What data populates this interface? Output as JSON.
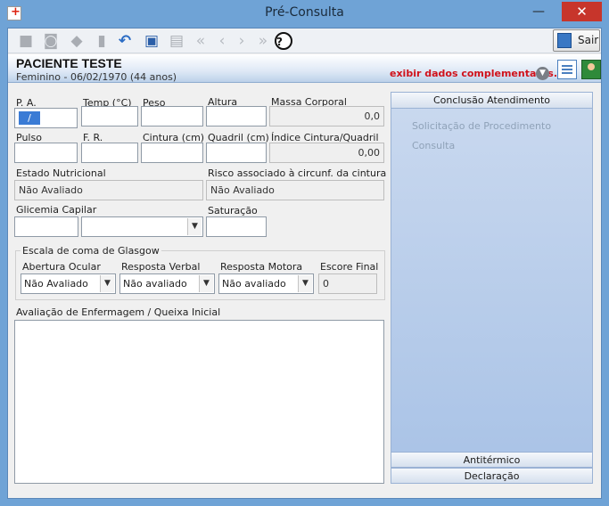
{
  "window": {
    "title": "Pré-Consulta",
    "min": "—",
    "max": "□",
    "close": "✕"
  },
  "toolbar": {
    "exit_label": "Sair",
    "help": "?"
  },
  "patient": {
    "name": "PACIENTE TESTE",
    "info": "Feminino - 06/02/1970 (44 anos)",
    "extra_link": "exibir dados complementares..."
  },
  "form": {
    "pa": {
      "label": "P. A.",
      "value": "/"
    },
    "temp": {
      "label": "Temp (°C)",
      "value": ""
    },
    "peso": {
      "label": "Peso",
      "value": ""
    },
    "altura": {
      "label": "Altura",
      "value": ""
    },
    "massa": {
      "label": "Massa Corporal",
      "value": "0,0"
    },
    "pulso": {
      "label": "Pulso",
      "value": ""
    },
    "fr": {
      "label": "F. R.",
      "value": ""
    },
    "cintura": {
      "label": "Cintura (cm)",
      "value": ""
    },
    "quadril": {
      "label": "Quadril (cm)",
      "value": ""
    },
    "indice": {
      "label": "Índice Cintura/Quadril",
      "value": "0,00"
    },
    "estado": {
      "label": "Estado Nutricional",
      "value": "Não Avaliado"
    },
    "risco": {
      "label": "Risco associado à circunf. da cintura",
      "value": "Não Avaliado"
    },
    "glicemia": {
      "label": "Glicemia Capilar",
      "value": "",
      "select": ""
    },
    "saturacao": {
      "label": "Saturação",
      "value": ""
    },
    "glasgow": {
      "title": "Escala de coma de Glasgow",
      "ocular": {
        "label": "Abertura Ocular",
        "value": "Não Avaliado"
      },
      "verbal": {
        "label": "Resposta Verbal",
        "value": "Não avaliado"
      },
      "motora": {
        "label": "Resposta Motora",
        "value": "Não avaliado"
      },
      "final": {
        "label": "Escore Final",
        "value": "0"
      }
    },
    "nursing": {
      "label": "Avaliação de Enfermagem / Queixa Inicial",
      "value": ""
    }
  },
  "panel": {
    "header": "Conclusão Atendimento",
    "links": [
      "Solicitação de Procedimento",
      "Consulta"
    ],
    "footer": [
      "Antitérmico",
      "Declaração"
    ]
  }
}
